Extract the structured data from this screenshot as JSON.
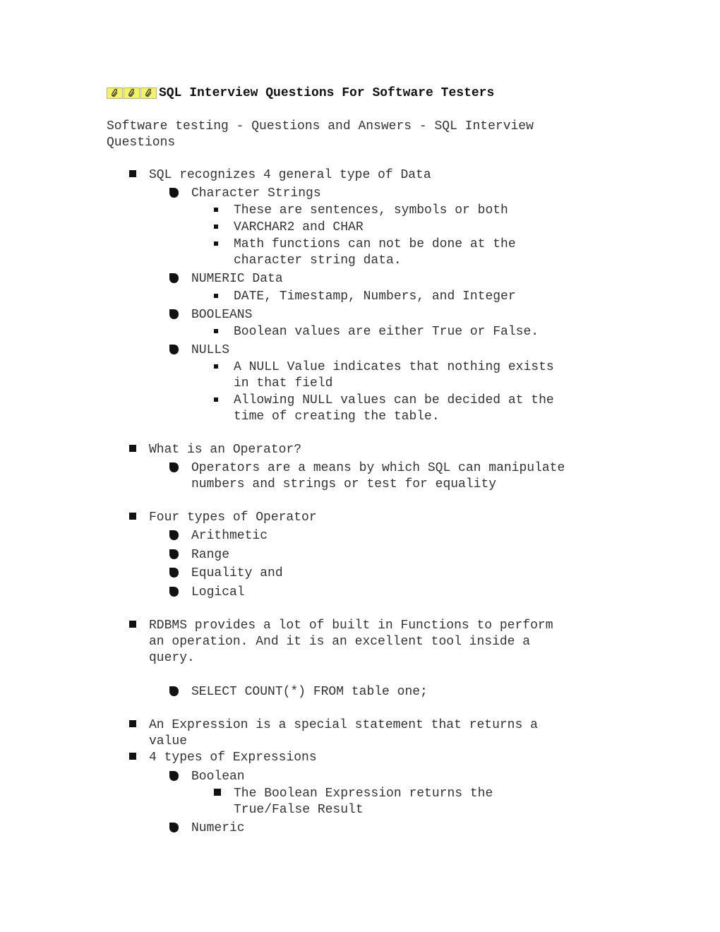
{
  "document": {
    "title_icons": [
      "paperclip-icon",
      "paperclip-icon",
      "paperclip-icon"
    ],
    "title": "SQL Interview Questions For Software Testers",
    "subtitle_line1": "Software testing - Questions and Answers - SQL Interview",
    "subtitle_line2": "Questions"
  },
  "items": [
    {
      "level": 1,
      "lines": [
        "SQL recognizes 4 general type of Data"
      ]
    },
    {
      "level": 2,
      "lines": [
        "Character Strings"
      ]
    },
    {
      "level": 3,
      "lines": [
        "These are sentences, symbols or both"
      ]
    },
    {
      "level": 3,
      "lines": [
        "VARCHAR2 and CHAR"
      ]
    },
    {
      "level": 3,
      "lines": [
        "Math functions can not be done at the",
        "character string data."
      ]
    },
    {
      "level": 2,
      "lines": [
        "NUMERIC Data"
      ]
    },
    {
      "level": 3,
      "lines": [
        "DATE, Timestamp, Numbers, and Integer"
      ]
    },
    {
      "level": 2,
      "lines": [
        "BOOLEANS"
      ]
    },
    {
      "level": 3,
      "lines": [
        "Boolean values are either True or False."
      ]
    },
    {
      "level": 2,
      "lines": [
        "NULLS"
      ]
    },
    {
      "level": 3,
      "lines": [
        "A NULL Value indicates that nothing exists",
        "in that field"
      ]
    },
    {
      "level": 3,
      "lines": [
        "Allowing NULL values can be decided at the",
        "time of creating the table."
      ]
    },
    {
      "level": 1,
      "lines": [
        "What is an Operator?"
      ]
    },
    {
      "level": 2,
      "lines": [
        "Operators are a means by which SQL can manipulate",
        "numbers and strings or test for equality"
      ]
    },
    {
      "level": 1,
      "lines": [
        "Four types of Operator"
      ]
    },
    {
      "level": 2,
      "lines": [
        "Arithmetic"
      ]
    },
    {
      "level": 2,
      "lines": [
        "Range"
      ]
    },
    {
      "level": 2,
      "lines": [
        "Equality and"
      ]
    },
    {
      "level": 2,
      "lines": [
        "Logical"
      ]
    },
    {
      "level": 1,
      "lines": [
        "RDBMS provides a lot of built in Functions to perform",
        "an operation. And it is an excellent tool inside a",
        "query."
      ]
    },
    {
      "level": 2,
      "lines": [
        "SELECT COUNT(*) FROM table one;"
      ]
    },
    {
      "level": 1,
      "lines": [
        "An Expression is a special statement that returns a",
        "value"
      ]
    },
    {
      "level": 1,
      "lines": [
        "4 types of Expressions"
      ]
    },
    {
      "level": 2,
      "lines": [
        "Boolean"
      ]
    },
    {
      "level": 3,
      "bullet": "large-square",
      "lines": [
        "The Boolean Expression returns the",
        "True/False Result"
      ]
    },
    {
      "level": 2,
      "lines": [
        "Numeric"
      ]
    }
  ]
}
